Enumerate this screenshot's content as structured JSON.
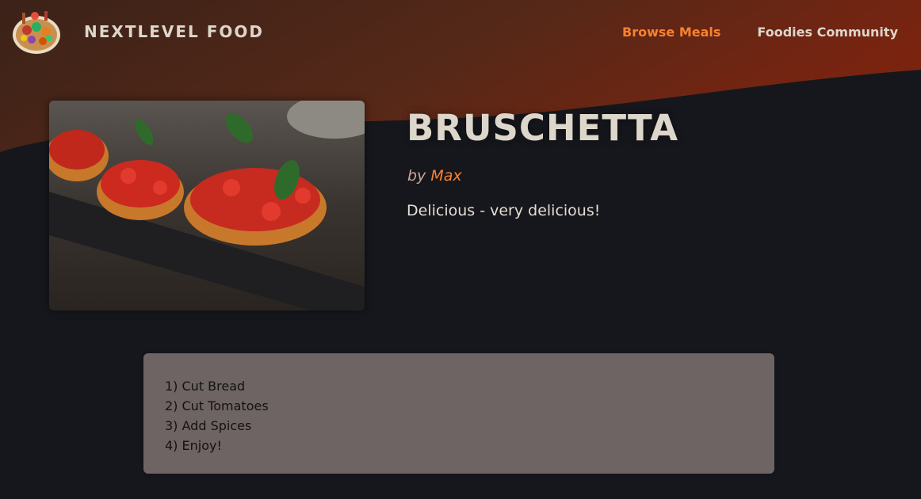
{
  "header": {
    "logo_alt": "A plate with food on it",
    "app_name": "NEXTLEVEL FOOD",
    "nav": [
      {
        "label": "Browse Meals",
        "active": true
      },
      {
        "label": "Foodies Community",
        "active": false
      }
    ]
  },
  "meal": {
    "image_alt": "Bruschetta",
    "title": "BRUSCHETTA",
    "by_prefix": "by",
    "creator": "Max",
    "summary": "Delicious - very delicious!",
    "instructions": [
      "1) Cut Bread",
      "2) Cut Tomatoes",
      "3) Add Spices",
      "4) Enjoy!"
    ]
  },
  "colors": {
    "background": "#16171c",
    "header_gradient_start": "#3b2218",
    "header_gradient_end": "#7a2410",
    "accent": "#f9822e",
    "text": "#ddd6cb",
    "instructions_bg": "#6e6464"
  }
}
